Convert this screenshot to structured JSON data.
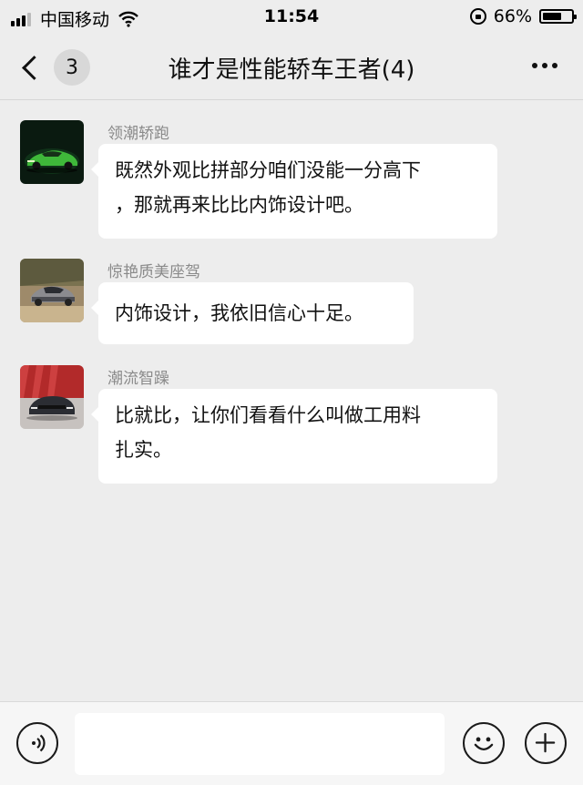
{
  "status_bar": {
    "carrier": "中国移动",
    "time": "11:54",
    "battery_percent": "66%",
    "battery_level": 0.66,
    "signal_icon": "signal-icon",
    "wifi_icon": "wifi-icon",
    "lock_icon": "rotation-lock-icon"
  },
  "nav": {
    "unread_count": "3",
    "title": "谁才是性能轿车王者(4)",
    "back_icon": "chevron-left-icon",
    "more_icon": "more-dots-icon"
  },
  "messages": [
    {
      "sender": "领潮轿跑",
      "lines": [
        "既然外观比拼部分咱们没能一分高下",
        "，那就再来比比内饰设计吧。"
      ]
    },
    {
      "sender": "惊艳质美座驾",
      "lines": [
        "内饰设计，我依旧信心十足。"
      ]
    },
    {
      "sender": "潮流智躁",
      "lines": [
        "比就比，让你们看看什么叫做工用料",
        "扎实。"
      ]
    }
  ],
  "input_bar": {
    "voice_icon": "voice-icon",
    "emoji_icon": "emoji-icon",
    "add_icon": "plus-icon",
    "placeholder": ""
  }
}
